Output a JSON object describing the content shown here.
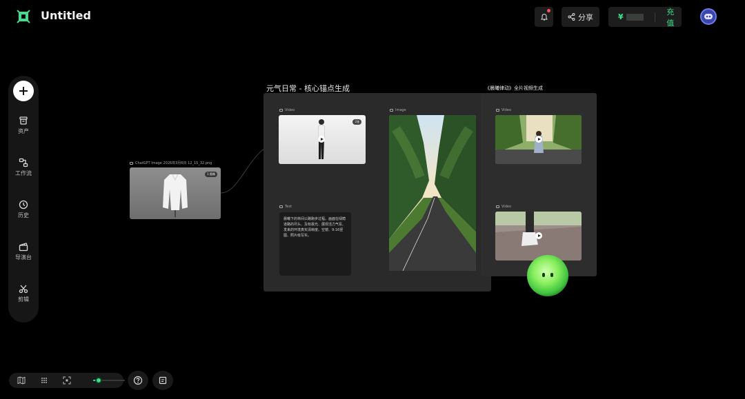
{
  "app": {
    "title": "Untitled"
  },
  "header": {
    "share_label": "分享",
    "wallet": {
      "currency": "¥",
      "recharge_label": "充值"
    }
  },
  "sidebar": {
    "items": [
      {
        "label": "资产",
        "icon": "archive-icon"
      },
      {
        "label": "工作流",
        "icon": "workflow-icon"
      },
      {
        "label": "历史",
        "icon": "clock-icon"
      },
      {
        "label": "导演台",
        "icon": "clapperboard-icon"
      },
      {
        "label": "剪辑",
        "icon": "scissors-icon"
      }
    ]
  },
  "canvas": {
    "source_node": {
      "label": "ChatGPT Image 2026年3月6日 12_15_32.png",
      "badge": "1 图像"
    },
    "group1": {
      "title": "元气日常 - 核心锚点生成",
      "video_label": "Video",
      "video_badge": "2张",
      "image_label": "Image",
      "text_label": "Text",
      "text_content": "晨曦下的林间公路跑步过程。画面在绿荫道路的尽头、及有晨光、展现活力气氛、发来的环境真实清晰度。空镜、9:16竖图、照片级写实。"
    },
    "group2": {
      "title": "《晨曦律动》全片视频生成",
      "video1_label": "Video",
      "video2_label": "Video"
    }
  },
  "colors": {
    "accent": "#3fdd8c",
    "background": "#000000",
    "panel": "#2a2a2a",
    "badge_dot": "#ff4d5e"
  }
}
